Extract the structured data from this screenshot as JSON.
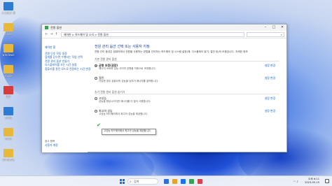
{
  "desktop": {
    "icons": [
      {
        "label": "스크린샷 편집기",
        "color": "#2e7bd6"
      },
      {
        "label": "node",
        "color": "#e7b93b"
      },
      {
        "label": "windows",
        "color": "#e7b93b"
      },
      {
        "label": "node",
        "color": "#e7b93b"
      },
      {
        "label": "PDF",
        "color": "#d83b3b"
      },
      {
        "label": "node",
        "color": "#2e7bd6"
      },
      {
        "label": "node",
        "color": "#e7b93b"
      },
      {
        "label": "windows",
        "color": "#e7b93b"
      }
    ]
  },
  "window": {
    "title": "전원 옵션",
    "address": "제어판  >  하드웨어 및 소리  >  전원 옵션",
    "search_placeholder": "",
    "sidebar": {
      "items": [
        "제어판 홈",
        "전원 단추 작동 설정",
        "덮개를 닫으면 수행되는 작업 선택",
        "전원 관리 옵션 만들기",
        "디스플레이를 끄는 시간 설정",
        "컴퓨터를 절전 모드로 전환하는 시간 변경"
      ],
      "see_also_title": "참고 항목",
      "see_also_link": "사용자 계정"
    },
    "main": {
      "heading": "전원 관리 옵션 선택 또는 사용자 지정",
      "description": "전원 관리 옵션은 컴퓨터에서 전원을 사용하는 방법을 관리하는 하드웨어 및 시스템 설정(예: 디스플레이 밝기, 절전 등)의 모음입니다. 자세한 정보",
      "section1": "기본 전원 관리 옵션",
      "section2": "추가 전원 관리 옵션 숨기기",
      "change_settings": "설정 변경",
      "plans": [
        {
          "name": "균형 조정(권장)",
          "desc": "에너지 소비와 성능 사이의 균형을 자동으로 조정합니다.",
          "selected": true
        },
        {
          "name": "절전",
          "desc": "가능한 경우 컴퓨터의 성능을 낮추어 에너지를 절약합니다.",
          "selected": false
        },
        {
          "name": "고성능",
          "desc": "성능을 향상시키지만 에너지를 더 많이 사용합니다.",
          "selected": false
        },
        {
          "name": "최고의 성능",
          "desc": "고성능 하드웨어에서 최고의 성능을 제공합니다.",
          "selected": false
        }
      ],
      "tooltip": "고성능 하드웨어에서 최고의 성능을 제공합니다."
    }
  },
  "taskbar": {
    "search_label": "검색",
    "time": "오후 6:11",
    "date": "2023-05-15",
    "app_colors": [
      "#2f6fd6",
      "#e2a52b",
      "#1a73e8",
      "#3aa05a",
      "#d8434d"
    ]
  }
}
